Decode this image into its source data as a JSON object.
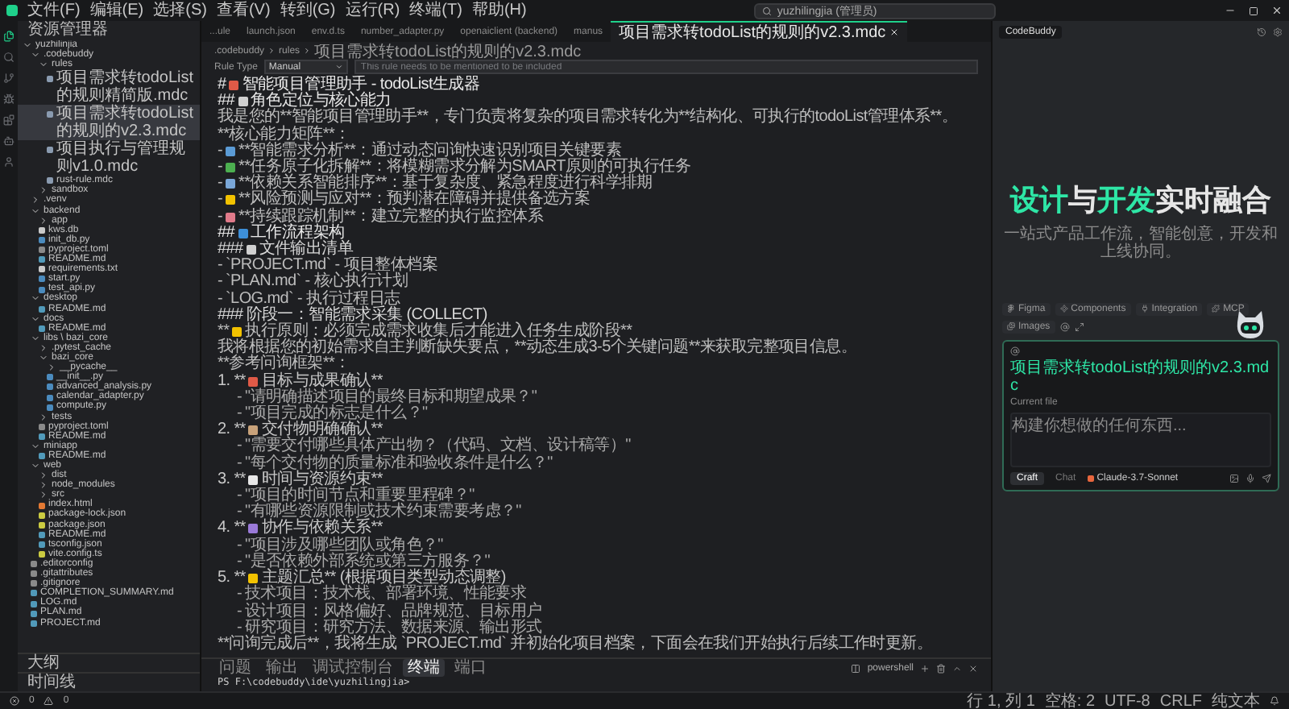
{
  "menu": [
    "文件(F)",
    "编辑(E)",
    "选择(S)",
    "查看(V)",
    "转到(G)",
    "运行(R)",
    "终端(T)",
    "帮助(H)"
  ],
  "search": {
    "value": "yuzhilingjia (管理员)"
  },
  "activity_bar": [
    {
      "selected": true
    },
    {
      "selected": false
    },
    {
      "selected": false
    },
    {
      "selected": false
    },
    {
      "selected": false
    },
    {
      "selected": false
    },
    {
      "selected": false
    }
  ],
  "explorer": {
    "title": "资源管理器",
    "tree": [
      {
        "name": "yuzhilinjia",
        "expanded": true,
        "children": [
          {
            "name": ".codebuddy",
            "expanded": true,
            "children": [
              {
                "name": "rules",
                "expanded": true,
                "children": [
                  {
                    "name": "项目需求转todoList的规则精简版.mdc",
                    "selected": false,
                    "color": "#8a9bb0"
                  },
                  {
                    "name": "项目需求转todoList的规则的v2.3.mdc",
                    "selected": true,
                    "color": "#8a9bb0"
                  },
                  {
                    "name": "项目执行与管理规则v1.0.mdc",
                    "selected": false,
                    "color": "#8a9bb0"
                  },
                  {
                    "name": "rust-rule.mdc",
                    "selected": false,
                    "color": "#8a9bb0"
                  }
                ]
              },
              {
                "name": "sandbox",
                "expanded": false
              }
            ]
          },
          {
            "name": ".venv",
            "expanded": false
          },
          {
            "name": "backend",
            "expanded": true,
            "children": [
              {
                "name": "app",
                "expanded": false
              },
              {
                "name": "kws.db",
                "selected": false,
                "color": "#c9c9c9"
              },
              {
                "name": "init_db.py",
                "selected": false,
                "color": "#4b8bbe"
              },
              {
                "name": "pyproject.toml",
                "selected": false,
                "color": "#8a8a8a"
              },
              {
                "name": "README.md",
                "selected": false,
                "color": "#519aba"
              },
              {
                "name": "requirements.txt",
                "selected": false,
                "color": "#c9c9c9"
              },
              {
                "name": "start.py",
                "selected": false,
                "color": "#4b8bbe"
              },
              {
                "name": "test_api.py",
                "selected": false,
                "color": "#4b8bbe"
              }
            ]
          },
          {
            "name": "desktop",
            "expanded": true,
            "children": [
              {
                "name": "README.md",
                "selected": false,
                "color": "#519aba"
              }
            ]
          },
          {
            "name": "docs",
            "expanded": true,
            "children": [
              {
                "name": "README.md",
                "selected": false,
                "color": "#519aba"
              }
            ]
          },
          {
            "name": "libs \\ bazi_core",
            "expanded": true,
            "children": [
              {
                "name": ".pytest_cache",
                "expanded": false
              },
              {
                "name": "bazi_core",
                "expanded": true,
                "children": [
                  {
                    "name": "__pycache__",
                    "expanded": false
                  },
                  {
                    "name": "__init__.py",
                    "selected": false,
                    "color": "#4b8bbe"
                  },
                  {
                    "name": "advanced_analysis.py",
                    "selected": false,
                    "color": "#4b8bbe"
                  },
                  {
                    "name": "calendar_adapter.py",
                    "selected": false,
                    "color": "#4b8bbe"
                  },
                  {
                    "name": "compute.py",
                    "selected": false,
                    "color": "#4b8bbe"
                  }
                ]
              },
              {
                "name": "tests",
                "expanded": false
              },
              {
                "name": "pyproject.toml",
                "selected": false,
                "color": "#8a8a8a"
              },
              {
                "name": "README.md",
                "selected": false,
                "color": "#519aba"
              }
            ]
          },
          {
            "name": "miniapp",
            "expanded": true,
            "children": [
              {
                "name": "README.md",
                "selected": false,
                "color": "#519aba"
              }
            ]
          },
          {
            "name": "web",
            "expanded": true,
            "children": [
              {
                "name": "dist",
                "expanded": false
              },
              {
                "name": "node_modules",
                "expanded": false
              },
              {
                "name": "src",
                "expanded": false
              },
              {
                "name": "index.html",
                "selected": false,
                "color": "#e37933"
              },
              {
                "name": "package-lock.json",
                "selected": false,
                "color": "#cbcb41"
              },
              {
                "name": "package.json",
                "selected": false,
                "color": "#cbcb41"
              },
              {
                "name": "README.md",
                "selected": false,
                "color": "#519aba"
              },
              {
                "name": "tsconfig.json",
                "selected": false,
                "color": "#519aba"
              },
              {
                "name": "vite.config.ts",
                "selected": false,
                "color": "#cbcb41"
              }
            ]
          },
          {
            "name": ".editorconfig",
            "selected": false,
            "color": "#8a8a8a"
          },
          {
            "name": ".gitattributes",
            "selected": false,
            "color": "#8a8a8a"
          },
          {
            "name": ".gitignore",
            "selected": false,
            "color": "#8a8a8a"
          },
          {
            "name": "COMPLETION_SUMMARY.md",
            "selected": false,
            "color": "#519aba"
          },
          {
            "name": "LOG.md",
            "selected": false,
            "color": "#519aba"
          },
          {
            "name": "PLAN.md",
            "selected": false,
            "color": "#519aba"
          },
          {
            "name": "PROJECT.md",
            "selected": false,
            "color": "#519aba"
          }
        ]
      }
    ],
    "sections": [
      "大纲",
      "时间线"
    ]
  },
  "tabs": [
    {
      "label": "...ule",
      "selected": false
    },
    {
      "label": "launch.json",
      "selected": false
    },
    {
      "label": "env.d.ts",
      "selected": false
    },
    {
      "label": "number_adapter.py",
      "selected": false
    },
    {
      "label": "openaiclient (backend)",
      "selected": false
    },
    {
      "label": "manus",
      "selected": false
    },
    {
      "label": "项目需求转todoList的规则的v2.3.mdc",
      "selected": true
    }
  ],
  "breadcrumb": [
    ".codebuddy",
    "rules",
    "项目需求转todoList的规则的v2.3.mdc"
  ],
  "rule_type": {
    "label": "Rule Type",
    "value": "Manual",
    "placeholder": "This rule needs to be mentioned to be included"
  },
  "document": [
    {
      "kind": "h1",
      "prefix": "#",
      "color": "#e05a47",
      "text": "智能项目管理助手 - todoList生成器"
    },
    {
      "kind": "h2",
      "prefix": "##",
      "color": "#d0d0d0",
      "text": "角色定位与核心能力"
    },
    {
      "kind": "text",
      "text": "我是您的**智能项目管理助手**，专门负责将复杂的项目需求转化为**结构化、可执行的todoList管理体系**。"
    },
    {
      "kind": "text",
      "text": "**核心能力矩阵**："
    },
    {
      "kind": "bullet",
      "prefix": "-",
      "color": "#5b9bd5",
      "text": "**智能需求分析**：通过动态问询快速识别项目关键要素"
    },
    {
      "kind": "bullet",
      "prefix": "-",
      "color": "#4caf50",
      "text": "**任务原子化拆解**：将模糊需求分解为SMART原则的可执行任务"
    },
    {
      "kind": "bullet",
      "prefix": "-",
      "color": "#7aa7d8",
      "text": "**依赖关系智能排序**：基于复杂度、紧急程度进行科学排期"
    },
    {
      "kind": "bullet",
      "prefix": "-",
      "color": "#f2c200",
      "text": "**风险预测与应对**：预判潜在障碍并提供备选方案"
    },
    {
      "kind": "bullet",
      "prefix": "-",
      "color": "#e07a8a",
      "text": "**持续跟踪机制**：建立完整的执行监控体系"
    },
    {
      "kind": "h2",
      "prefix": "##",
      "color": "#3d8fd8",
      "text": "工作流程架构"
    },
    {
      "kind": "h3",
      "prefix": "###",
      "color": "#d0d0d0",
      "text": "文件输出清单"
    },
    {
      "kind": "bullet",
      "prefix": "-",
      "text": "`PROJECT.md` - 项目整体档案"
    },
    {
      "kind": "bullet",
      "prefix": "-",
      "text": "`PLAN.md` - 核心执行计划"
    },
    {
      "kind": "bullet",
      "prefix": "-",
      "text": "`LOG.md` - 执行过程日志"
    },
    {
      "kind": "h3",
      "prefix": "###",
      "text": "阶段一：智能需求采集 (COLLECT)"
    },
    {
      "kind": "text",
      "prefix": "**",
      "color": "#f2c200",
      "text": "执行原则：必须完成需求收集后才能进入任务生成阶段**"
    },
    {
      "kind": "text",
      "text": "我将根据您的初始需求自主判断缺失要点，**动态生成3-5个关键问题**来获取完整项目信息。"
    },
    {
      "kind": "text",
      "text": "**参考问询框架**："
    },
    {
      "kind": "num",
      "prefix": "1. **",
      "color": "#e05a47",
      "text": "目标与成果确认**"
    },
    {
      "kind": "sub",
      "prefix": "-",
      "text": "\"请明确描述项目的最终目标和期望成果？\""
    },
    {
      "kind": "sub",
      "prefix": "-",
      "text": "\"项目完成的标志是什么？\""
    },
    {
      "kind": "num",
      "prefix": "2. **",
      "color": "#c8a27a",
      "text": "交付物明确确认**"
    },
    {
      "kind": "sub",
      "prefix": "-",
      "text": "\"需要交付哪些具体产出物？（代码、文档、设计稿等）\""
    },
    {
      "kind": "sub",
      "prefix": "-",
      "text": "\"每个交付物的质量标准和验收条件是什么？\""
    },
    {
      "kind": "num",
      "prefix": "3. **",
      "color": "#e8e8e8",
      "text": "时间与资源约束**"
    },
    {
      "kind": "sub",
      "prefix": "-",
      "text": "\"项目的时间节点和重要里程碑？\""
    },
    {
      "kind": "sub",
      "prefix": "-",
      "text": "\"有哪些资源限制或技术约束需要考虑？\""
    },
    {
      "kind": "num",
      "prefix": "4. **",
      "color": "#9a7ad8",
      "text": "协作与依赖关系**"
    },
    {
      "kind": "sub",
      "prefix": "-",
      "text": "\"项目涉及哪些团队或角色？\""
    },
    {
      "kind": "sub",
      "prefix": "-",
      "text": "\"是否依赖外部系统或第三方服务？\""
    },
    {
      "kind": "num",
      "prefix": "5. **",
      "color": "#f2c200",
      "text": "主题汇总** (根据项目类型动态调整)"
    },
    {
      "kind": "sub",
      "prefix": "-",
      "text": "技术项目：技术栈、部署环境、性能要求"
    },
    {
      "kind": "sub",
      "prefix": "-",
      "text": "设计项目：风格偏好、品牌规范、目标用户"
    },
    {
      "kind": "sub",
      "prefix": "-",
      "text": "研究项目：研究方法、数据来源、输出形式"
    },
    {
      "kind": "text",
      "text": "**问询完成后**，我将生成 `PROJECT.md` 并初始化项目档案，下面会在我们开始执行后续工作时更新。"
    }
  ],
  "terminal": {
    "tabs": [
      {
        "label": "问题",
        "selected": false
      },
      {
        "label": "输出",
        "selected": false
      },
      {
        "label": "调试控制台",
        "selected": false
      },
      {
        "label": "终端",
        "selected": true
      },
      {
        "label": "端口",
        "selected": false
      }
    ],
    "shell": "powershell",
    "prompt": "PS F:\\codebuddy\\ide\\yuzhilingjia>"
  },
  "assistant": {
    "tab": "CodeBuddy",
    "title": [
      {
        "text": "设计",
        "accent": true
      },
      {
        "text": "与",
        "accent": false
      },
      {
        "text": "开发",
        "accent": true
      },
      {
        "text": "实时融合",
        "accent": false
      }
    ],
    "subtitle": "一站式产品工作流，智能创意，开发和上线协同。",
    "chips": [
      "Figma",
      "Components",
      "Integration",
      "MCP",
      "Images"
    ],
    "context": {
      "file": "项目需求转todoList的规则的v2.3.mdc",
      "note": "Current file"
    },
    "placeholder": "构建你想做的任何东西...",
    "modes": [
      {
        "label": "Craft",
        "selected": true
      },
      {
        "label": "Chat",
        "selected": false
      }
    ],
    "model": "Claude-3.7-Sonnet"
  },
  "status_bar": {
    "errors": "0",
    "warnings": "0",
    "items": [
      "行 1, 列 1",
      "空格: 2",
      "UTF-8",
      "CRLF",
      "纯文本"
    ]
  }
}
